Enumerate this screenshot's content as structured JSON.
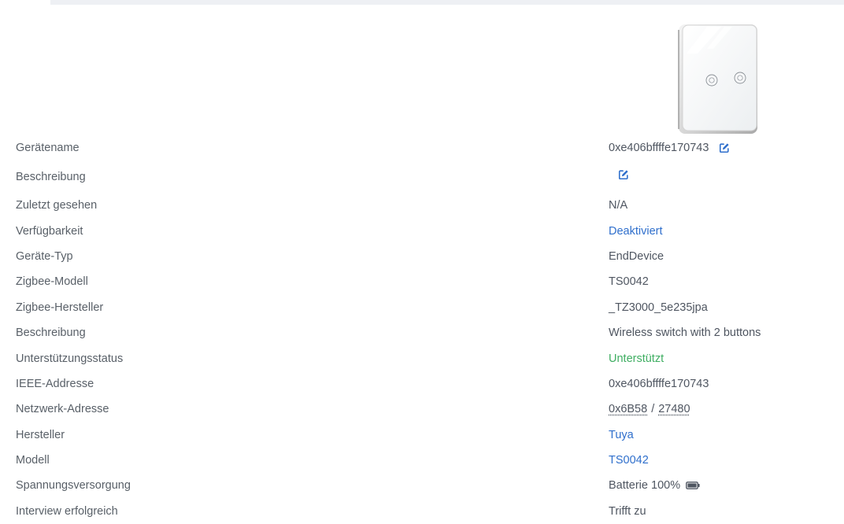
{
  "device": {
    "image_alt": "Wireless switch with 2 buttons"
  },
  "rows": {
    "name": {
      "label": "Gerätename",
      "value": "0xe406bffffe170743"
    },
    "description_edit": {
      "label": "Beschreibung",
      "value": ""
    },
    "last_seen": {
      "label": "Zuletzt gesehen",
      "value": "N/A"
    },
    "availability": {
      "label": "Verfügbarkeit",
      "value": "Deaktiviert"
    },
    "device_type": {
      "label": "Geräte-Typ",
      "value": "EndDevice"
    },
    "zigbee_model": {
      "label": "Zigbee-Modell",
      "value": "TS0042"
    },
    "zigbee_manufacturer": {
      "label": "Zigbee-Hersteller",
      "value": "_TZ3000_5e235jpa"
    },
    "description": {
      "label": "Beschreibung",
      "value": "Wireless switch with 2 buttons"
    },
    "support_status": {
      "label": "Unterstützungsstatus",
      "value": "Unterstützt"
    },
    "ieee_address": {
      "label": "IEEE-Addresse",
      "value": "0xe406bffffe170743"
    },
    "network_address": {
      "label": "Netzwerk-Adresse",
      "value_hex": "0x6B58",
      "separator": "/",
      "value_dec": "27480"
    },
    "manufacturer": {
      "label": "Hersteller",
      "value": "Tuya"
    },
    "model": {
      "label": "Modell",
      "value": "TS0042"
    },
    "power_source": {
      "label": "Spannungsversorgung",
      "value": "Batterie 100%"
    },
    "interview": {
      "label": "Interview erfolgreich",
      "value": "Trifft zu"
    }
  },
  "colors": {
    "link": "#2f6fcc",
    "supported": "#3fae62",
    "text": "#4f5661",
    "label": "#596068"
  },
  "icons": {
    "edit": "edit-icon",
    "battery": "battery-full-icon"
  }
}
